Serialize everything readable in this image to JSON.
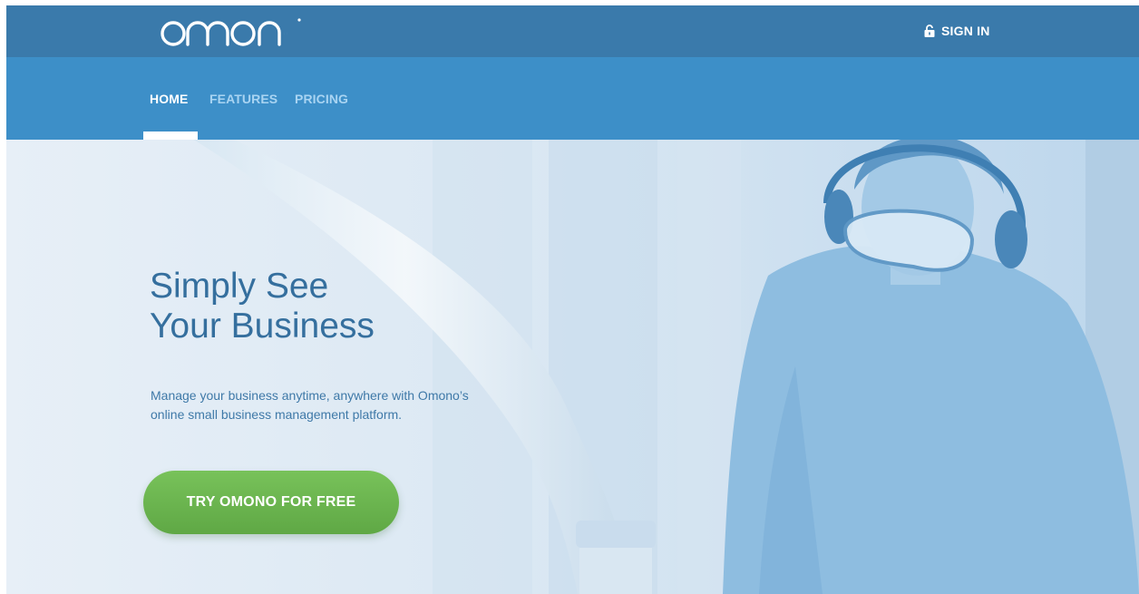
{
  "brand": {
    "logo_text": "omono"
  },
  "header": {
    "signin_label": "SIGN IN"
  },
  "nav": {
    "items": [
      {
        "label": "HOME",
        "active": true
      },
      {
        "label": "FEATURES",
        "active": false
      },
      {
        "label": "PRICING",
        "active": false
      }
    ]
  },
  "hero": {
    "headline_line1": "Simply See",
    "headline_line2": "Your Business",
    "subtext_line1": "Manage your business anytime, anywhere with Omono’s",
    "subtext_line2": "online small business management platform.",
    "cta_label": "TRY OMONO FOR FREE"
  },
  "icons": {
    "signin": "lock-icon"
  },
  "colors": {
    "topbar": "#3a7aab",
    "navbar": "#3d8fc8",
    "headline": "#356f9e",
    "cta": "#6db650"
  }
}
